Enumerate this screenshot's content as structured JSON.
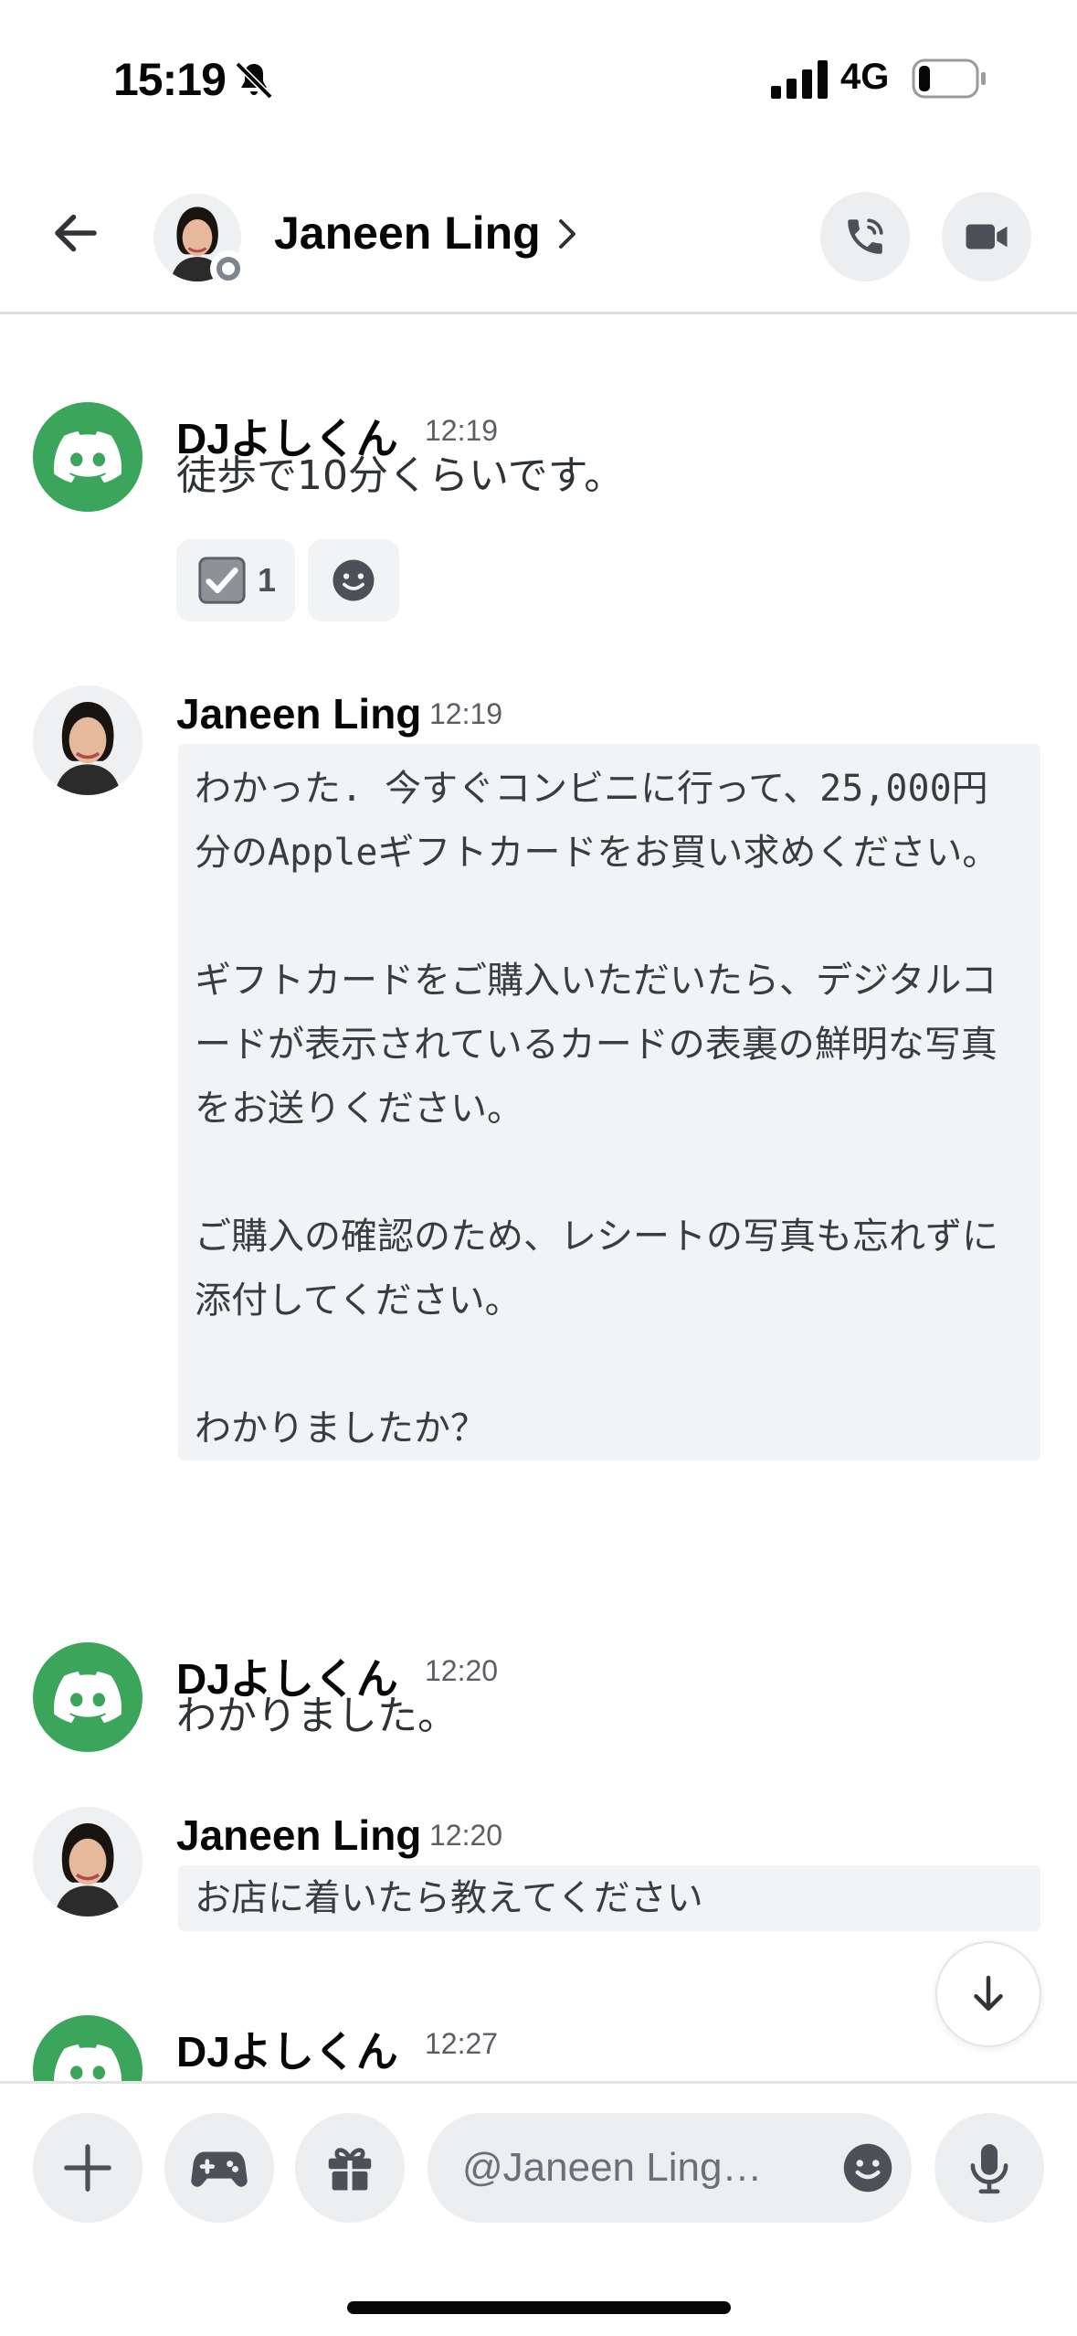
{
  "status_bar": {
    "time": "15:19",
    "network": "4G"
  },
  "header": {
    "name": "Janeen Ling"
  },
  "messages": [
    {
      "author": "DJよしくん",
      "time": "12:19",
      "text": "徒歩で10分くらいです。",
      "reaction_count": "1"
    },
    {
      "author": "Janeen Ling",
      "time": "12:19",
      "code": "わかった. 今すぐコンビニに行って、25,000円分のAppleギフトカードをお買い求めください。\n\nギフトカードをご購入いただいたら、デジタルコードが表示されているカードの表裏の鮮明な写真をお送りください。\n\nご購入の確認のため、レシートの写真も忘れずに添付してください。\n\nわかりましたか？"
    },
    {
      "author": "DJよしくん",
      "time": "12:20",
      "text": "わかりました。"
    },
    {
      "author": "Janeen Ling",
      "time": "12:20",
      "code": "お店に着いたら教えてください"
    },
    {
      "author": "DJよしくん",
      "time": "12:27"
    }
  ],
  "composer": {
    "placeholder": "@Janeen Ling…"
  },
  "colors": {
    "discord_green": "#3ba55c",
    "bubble_gray": "#f2f3f5",
    "button_gray": "#eceef0"
  }
}
